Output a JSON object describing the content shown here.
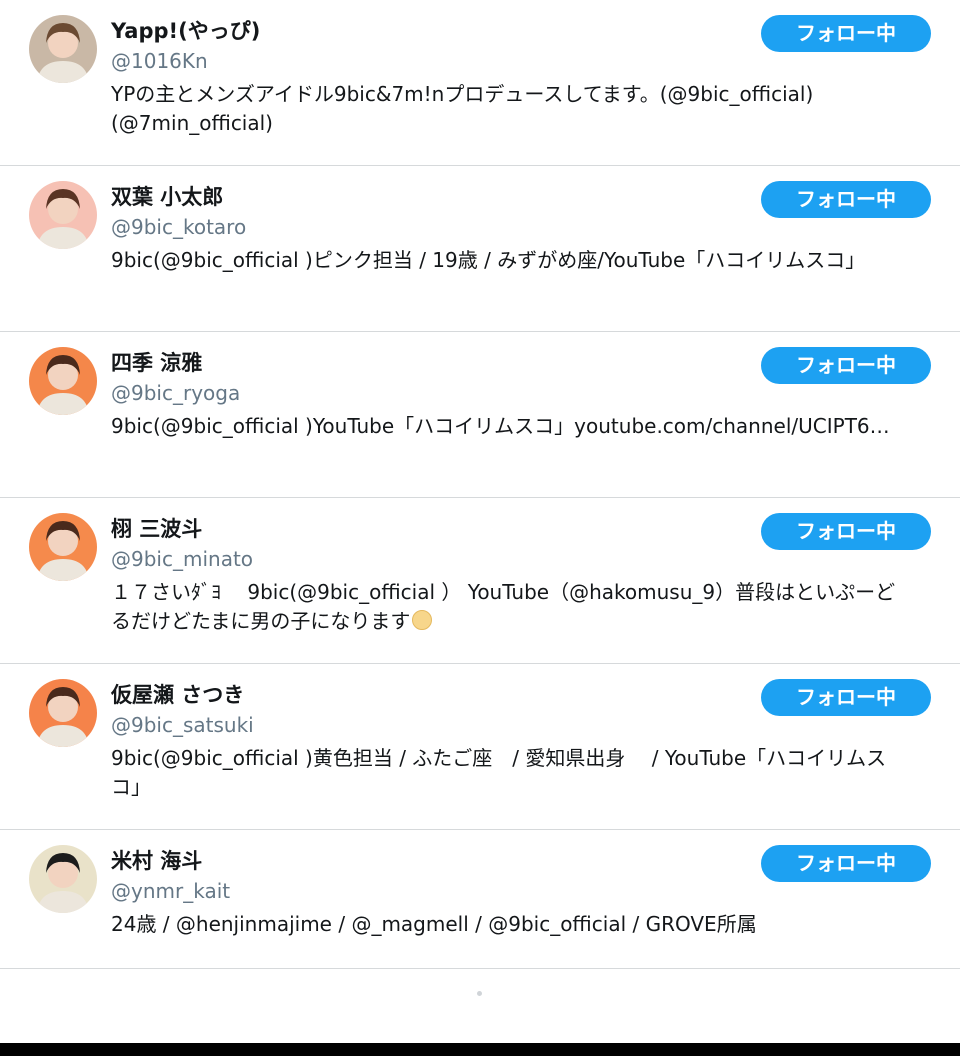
{
  "follow_label": "フォロー中",
  "users": [
    {
      "name": "Yapp!(やっぴ)",
      "handle": "@1016Kn",
      "bio": "YPの主とメンズアイドル9bic&7m!nプロデュースしてます。(@9bic_official)(@7min_official)",
      "avatar_bg": "#c9b8a6",
      "avatar_fg": "#6b4a32"
    },
    {
      "name": "双葉 小太郎",
      "handle": "@9bic_kotaro",
      "bio": "9bic(@9bic_official )ピンク担当 / 19歳 / みずがめ座/YouTube「ハコイリムスコ」",
      "avatar_bg": "#f6c1b4",
      "avatar_fg": "#5a3424"
    },
    {
      "name": "四季 涼雅",
      "handle": "@9bic_ryoga",
      "bio": "9bic(@9bic_official )YouTube「ハコイリムスコ」youtube.com/channel/UCIPT6…",
      "avatar_bg": "#f4874a",
      "avatar_fg": "#4a2a1c"
    },
    {
      "name": "栩 三波斗",
      "handle": "@9bic_minato",
      "bio": "１７さいﾀﾞﾖ　 9bic(@9bic_official ） YouTube（@hakomusu_9）普段はといぷーどるだけどたまに男の子になります",
      "bio_emoji": "face-emoji",
      "avatar_bg": "#f58a4c",
      "avatar_fg": "#4a2a1c"
    },
    {
      "name": "仮屋瀬 さつき",
      "handle": "@9bic_satsuki",
      "bio": "9bic(@9bic_official )黄色担当 / ふたご座　/ 愛知県出身　 / YouTube「ハコイリムスコ」",
      "avatar_bg": "#f5834a",
      "avatar_fg": "#4a2a1c"
    },
    {
      "name": "米村 海斗",
      "handle": "@ynmr_kait",
      "bio": "24歳 / @henjinmajime / @_magmell / @9bic_official / GROVE所属",
      "avatar_bg": "#e9e2c9",
      "avatar_fg": "#1c1c1c"
    }
  ],
  "colors": {
    "accent": "#1da1f2",
    "handle": "#657786",
    "divider": "#d6d9db"
  }
}
